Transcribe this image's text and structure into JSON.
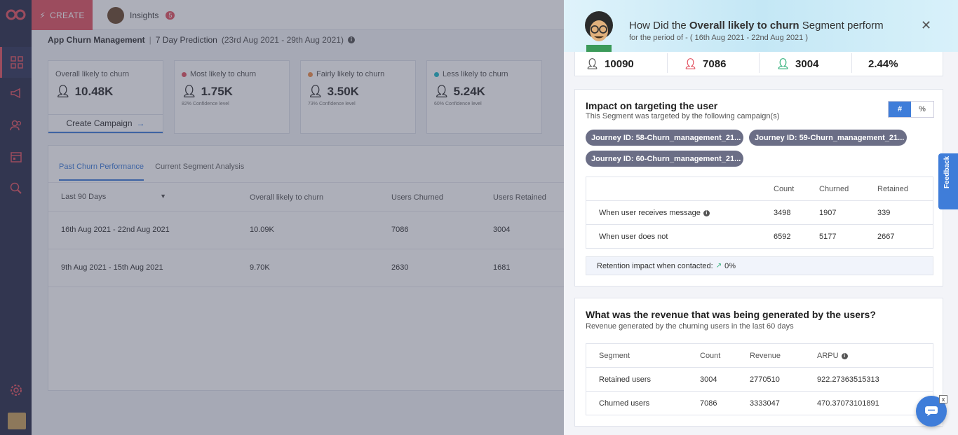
{
  "topbar": {
    "create_label": "CREATE",
    "insights_label": "Insights",
    "insights_badge": "5"
  },
  "breadcrumb": {
    "title": "App Churn Management",
    "prediction": "7 Day Prediction",
    "range": "(23rd Aug 2021 - 29th Aug 2021)"
  },
  "cards": [
    {
      "title": "Overall likely to churn",
      "value": "10.48K",
      "confidence": "",
      "cta": "Create Campaign"
    },
    {
      "title": "Most likely to churn",
      "value": "1.75K",
      "confidence": "82% Confidence level",
      "dot_color": "#e25563"
    },
    {
      "title": "Fairly likely to churn",
      "value": "3.50K",
      "confidence": "73% Confidence level",
      "dot_color": "#ef8f4a"
    },
    {
      "title": "Less likely to churn",
      "value": "5.24K",
      "confidence": "60% Confidence level",
      "dot_color": "#1fb9c9"
    }
  ],
  "tabs": [
    "Past Churn Performance",
    "Current Segment Analysis"
  ],
  "table": {
    "filter": "Last 90 Days",
    "headers": [
      "Overall likely to churn",
      "Users Churned",
      "Users Retained"
    ],
    "rows": [
      {
        "period": "16th Aug 2021 - 22nd Aug 2021",
        "overall": "10.09K",
        "churned": "7086",
        "retained": "3004"
      },
      {
        "period": "9th Aug 2021 - 15th Aug 2021",
        "overall": "9.70K",
        "churned": "2630",
        "retained": "1681"
      }
    ]
  },
  "panel": {
    "question_pre": "How Did the",
    "question_bold": "Overall likely to churn",
    "question_post": "Segment perform",
    "period": "for the period of - ( 16th Aug 2021 - 22nd Aug 2021 )",
    "stats": {
      "total": "10090",
      "churned": "7086",
      "retained": "3004",
      "rate": "2.44%"
    },
    "impact": {
      "title": "Impact on targeting the user",
      "subtitle": "This Segment was targeted by the following campaign(s)",
      "toggle_count": "#",
      "toggle_pct": "%",
      "chips": [
        "Journey ID: 58-Churn_management_21...",
        "Journey ID: 59-Churn_management_21...",
        "Journey ID: 60-Churn_management_21..."
      ],
      "headers": [
        "Count",
        "Churned",
        "Retained"
      ],
      "rows": [
        {
          "label": "When user receives message",
          "count": "3498",
          "churned": "1907",
          "retained": "339"
        },
        {
          "label": "When user does not",
          "count": "6592",
          "churned": "5177",
          "retained": "2667"
        }
      ],
      "retention_label": "Retention impact when contacted:",
      "retention_value": "0%"
    },
    "revenue": {
      "title": "What was the revenue that was being generated by the users?",
      "subtitle": "Revenue generated by the churning users in the last 60 days",
      "headers": [
        "Segment",
        "Count",
        "Revenue",
        "ARPU"
      ],
      "rows": [
        {
          "segment": "Retained users",
          "count": "3004",
          "revenue": "2770510",
          "arpu": "922.27363515313"
        },
        {
          "segment": "Churned users",
          "count": "7086",
          "revenue": "3333047",
          "arpu": "470.37073101891"
        }
      ]
    }
  },
  "feedback_label": "Feedback",
  "colors": {
    "accent": "#3f7dd9",
    "brand": "#e25563",
    "nav": "#2b2f4a",
    "churned": "#e25563",
    "retained": "#2eaf79"
  }
}
